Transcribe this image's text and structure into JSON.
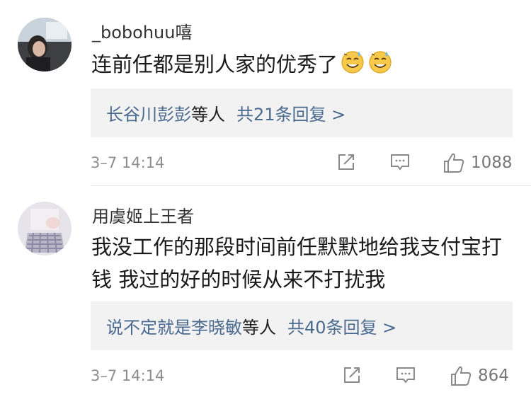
{
  "comments": [
    {
      "username": "_bobohuu嘻",
      "text": "连前任都是别人家的优秀了",
      "emojis": [
        "smile-sweat-emoji",
        "smile-sweat-emoji"
      ],
      "reply_users": "长谷川彭彭",
      "reply_suffix": "等人",
      "reply_count": "共21条回复 >",
      "time": "3–7 14:14",
      "likes": "1088"
    },
    {
      "username": "用虞姬上王者",
      "text": "我没工作的那段时间前任默默地给我支付宝打钱 我过的好的时候从来不打扰我",
      "reply_users": "说不定就是李晓敏",
      "reply_suffix": "等人",
      "reply_count": "共40条回复 >",
      "time": "3–7 14:14",
      "likes": "864"
    }
  ],
  "colors": {
    "link": "#4a6a8f",
    "meta": "#8e8e8e",
    "reply_bg": "#f2f2f2"
  }
}
